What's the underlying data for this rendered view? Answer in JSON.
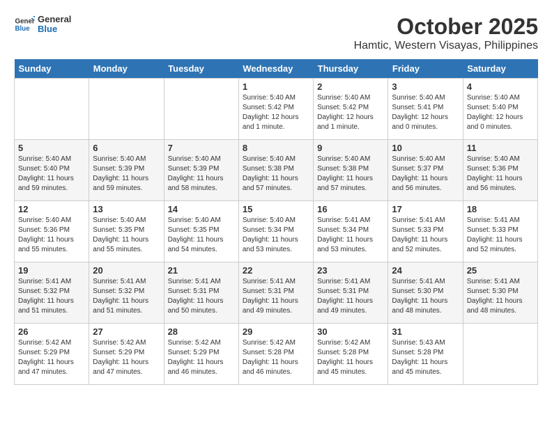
{
  "header": {
    "logo_line1": "General",
    "logo_line2": "Blue",
    "title": "October 2025",
    "subtitle": "Hamtic, Western Visayas, Philippines"
  },
  "days_of_week": [
    "Sunday",
    "Monday",
    "Tuesday",
    "Wednesday",
    "Thursday",
    "Friday",
    "Saturday"
  ],
  "weeks": [
    [
      {
        "day": "",
        "info": ""
      },
      {
        "day": "",
        "info": ""
      },
      {
        "day": "",
        "info": ""
      },
      {
        "day": "1",
        "info": "Sunrise: 5:40 AM\nSunset: 5:42 PM\nDaylight: 12 hours\nand 1 minute."
      },
      {
        "day": "2",
        "info": "Sunrise: 5:40 AM\nSunset: 5:42 PM\nDaylight: 12 hours\nand 1 minute."
      },
      {
        "day": "3",
        "info": "Sunrise: 5:40 AM\nSunset: 5:41 PM\nDaylight: 12 hours\nand 0 minutes."
      },
      {
        "day": "4",
        "info": "Sunrise: 5:40 AM\nSunset: 5:40 PM\nDaylight: 12 hours\nand 0 minutes."
      }
    ],
    [
      {
        "day": "5",
        "info": "Sunrise: 5:40 AM\nSunset: 5:40 PM\nDaylight: 11 hours\nand 59 minutes."
      },
      {
        "day": "6",
        "info": "Sunrise: 5:40 AM\nSunset: 5:39 PM\nDaylight: 11 hours\nand 59 minutes."
      },
      {
        "day": "7",
        "info": "Sunrise: 5:40 AM\nSunset: 5:39 PM\nDaylight: 11 hours\nand 58 minutes."
      },
      {
        "day": "8",
        "info": "Sunrise: 5:40 AM\nSunset: 5:38 PM\nDaylight: 11 hours\nand 57 minutes."
      },
      {
        "day": "9",
        "info": "Sunrise: 5:40 AM\nSunset: 5:38 PM\nDaylight: 11 hours\nand 57 minutes."
      },
      {
        "day": "10",
        "info": "Sunrise: 5:40 AM\nSunset: 5:37 PM\nDaylight: 11 hours\nand 56 minutes."
      },
      {
        "day": "11",
        "info": "Sunrise: 5:40 AM\nSunset: 5:36 PM\nDaylight: 11 hours\nand 56 minutes."
      }
    ],
    [
      {
        "day": "12",
        "info": "Sunrise: 5:40 AM\nSunset: 5:36 PM\nDaylight: 11 hours\nand 55 minutes."
      },
      {
        "day": "13",
        "info": "Sunrise: 5:40 AM\nSunset: 5:35 PM\nDaylight: 11 hours\nand 55 minutes."
      },
      {
        "day": "14",
        "info": "Sunrise: 5:40 AM\nSunset: 5:35 PM\nDaylight: 11 hours\nand 54 minutes."
      },
      {
        "day": "15",
        "info": "Sunrise: 5:40 AM\nSunset: 5:34 PM\nDaylight: 11 hours\nand 53 minutes."
      },
      {
        "day": "16",
        "info": "Sunrise: 5:41 AM\nSunset: 5:34 PM\nDaylight: 11 hours\nand 53 minutes."
      },
      {
        "day": "17",
        "info": "Sunrise: 5:41 AM\nSunset: 5:33 PM\nDaylight: 11 hours\nand 52 minutes."
      },
      {
        "day": "18",
        "info": "Sunrise: 5:41 AM\nSunset: 5:33 PM\nDaylight: 11 hours\nand 52 minutes."
      }
    ],
    [
      {
        "day": "19",
        "info": "Sunrise: 5:41 AM\nSunset: 5:32 PM\nDaylight: 11 hours\nand 51 minutes."
      },
      {
        "day": "20",
        "info": "Sunrise: 5:41 AM\nSunset: 5:32 PM\nDaylight: 11 hours\nand 51 minutes."
      },
      {
        "day": "21",
        "info": "Sunrise: 5:41 AM\nSunset: 5:31 PM\nDaylight: 11 hours\nand 50 minutes."
      },
      {
        "day": "22",
        "info": "Sunrise: 5:41 AM\nSunset: 5:31 PM\nDaylight: 11 hours\nand 49 minutes."
      },
      {
        "day": "23",
        "info": "Sunrise: 5:41 AM\nSunset: 5:31 PM\nDaylight: 11 hours\nand 49 minutes."
      },
      {
        "day": "24",
        "info": "Sunrise: 5:41 AM\nSunset: 5:30 PM\nDaylight: 11 hours\nand 48 minutes."
      },
      {
        "day": "25",
        "info": "Sunrise: 5:41 AM\nSunset: 5:30 PM\nDaylight: 11 hours\nand 48 minutes."
      }
    ],
    [
      {
        "day": "26",
        "info": "Sunrise: 5:42 AM\nSunset: 5:29 PM\nDaylight: 11 hours\nand 47 minutes."
      },
      {
        "day": "27",
        "info": "Sunrise: 5:42 AM\nSunset: 5:29 PM\nDaylight: 11 hours\nand 47 minutes."
      },
      {
        "day": "28",
        "info": "Sunrise: 5:42 AM\nSunset: 5:29 PM\nDaylight: 11 hours\nand 46 minutes."
      },
      {
        "day": "29",
        "info": "Sunrise: 5:42 AM\nSunset: 5:28 PM\nDaylight: 11 hours\nand 46 minutes."
      },
      {
        "day": "30",
        "info": "Sunrise: 5:42 AM\nSunset: 5:28 PM\nDaylight: 11 hours\nand 45 minutes."
      },
      {
        "day": "31",
        "info": "Sunrise: 5:43 AM\nSunset: 5:28 PM\nDaylight: 11 hours\nand 45 minutes."
      },
      {
        "day": "",
        "info": ""
      }
    ]
  ]
}
